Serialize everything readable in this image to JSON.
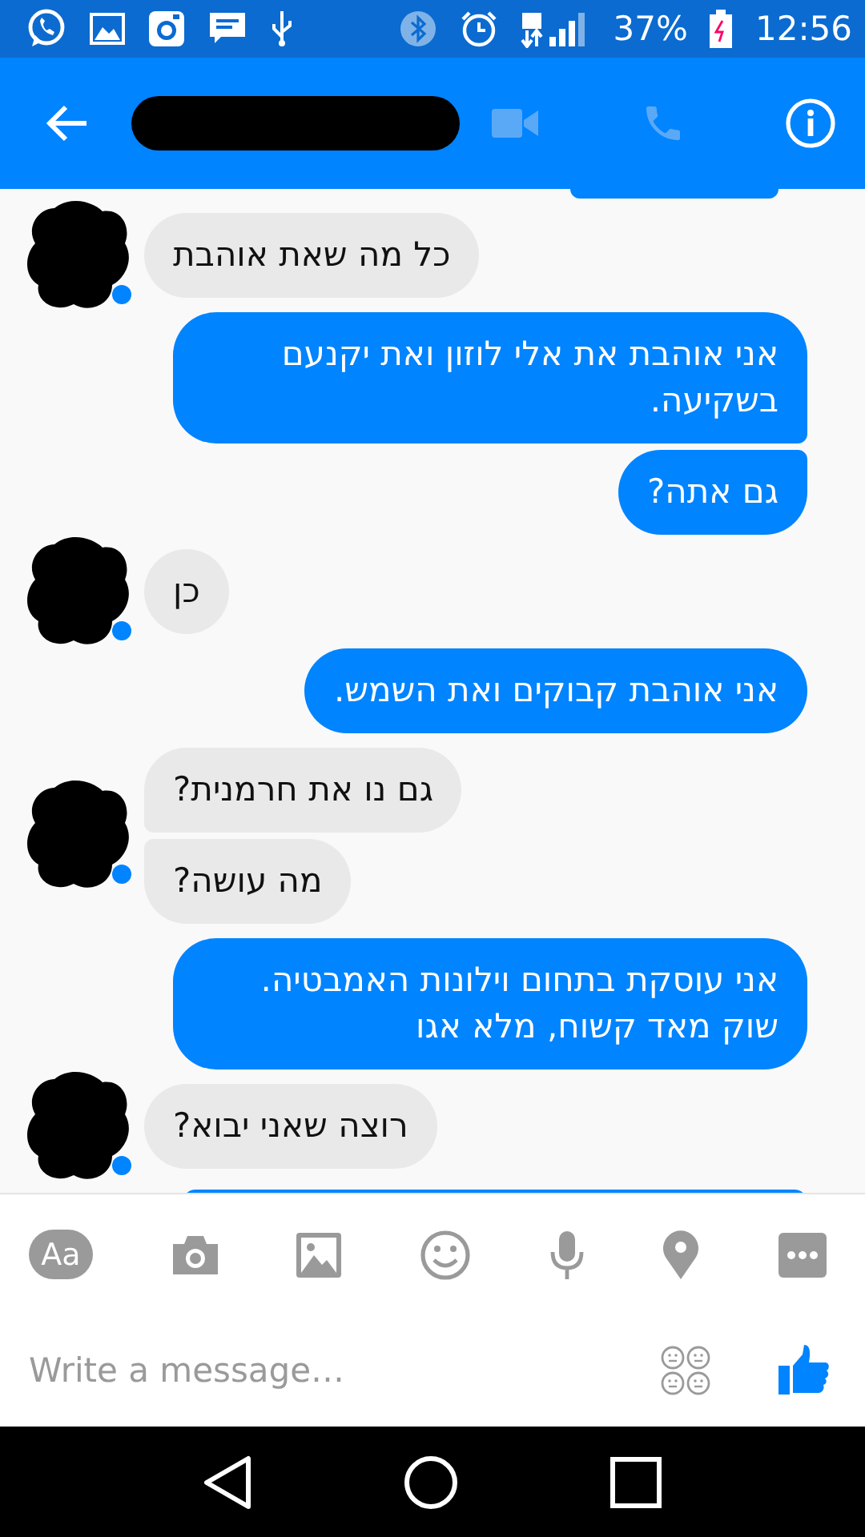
{
  "status_bar": {
    "battery": "37%",
    "time": "12:56"
  },
  "groups": [
    {
      "kind": "clipped",
      "outgoing": true
    },
    {
      "kind": "messages",
      "outgoing": false,
      "messages": [
        "כל מה שאת אוהבת"
      ]
    },
    {
      "kind": "messages",
      "outgoing": true,
      "messages": [
        "אני אוהבת את אלי לוזון ואת יקנעם בשקיעה.",
        "גם אתה?"
      ]
    },
    {
      "kind": "messages",
      "outgoing": false,
      "messages": [
        "כן"
      ]
    },
    {
      "kind": "messages",
      "outgoing": true,
      "messages": [
        "אני אוהבת קבוקים ואת השמש."
      ]
    },
    {
      "kind": "messages",
      "outgoing": false,
      "messages": [
        "גם נו את חרמנית?",
        "מה עושה?"
      ]
    },
    {
      "kind": "messages",
      "outgoing": true,
      "messages": [
        "אני עוסקת בתחום וילונות האמבטיה. שוק מאד קשוח, מלא אגו"
      ]
    },
    {
      "kind": "messages",
      "outgoing": false,
      "messages": [
        "רוצה שאני יבוא?"
      ]
    },
    {
      "kind": "clipped",
      "outgoing": true
    }
  ],
  "toolbar": {
    "text_button": "Aa"
  },
  "composer": {
    "placeholder": "Write a message…"
  }
}
